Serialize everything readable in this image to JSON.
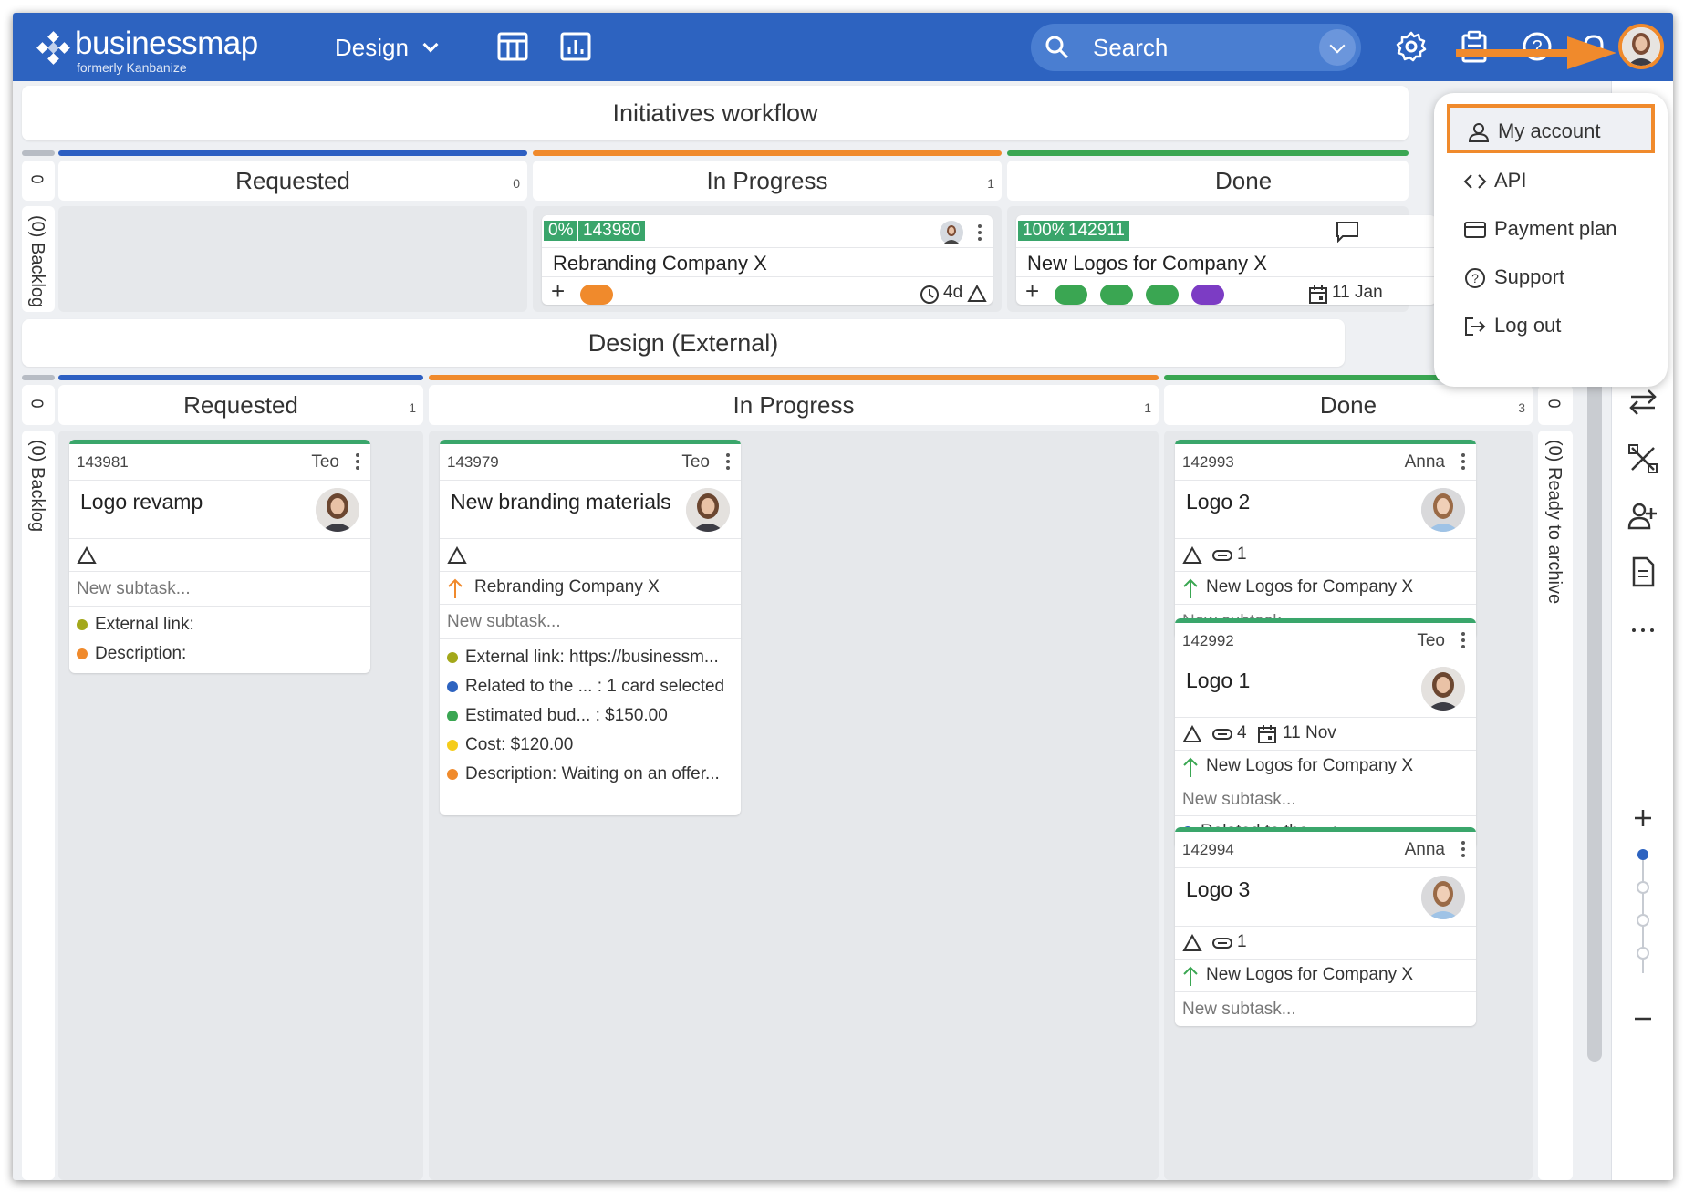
{
  "app": {
    "brand": "businessmap",
    "brand_sub": "formerly Kanbanize",
    "workspace": "Design",
    "search_placeholder": "Search",
    "accent": "#2d63c0",
    "highlight": "#f08a2c"
  },
  "user_menu": {
    "items": [
      {
        "label": "My account",
        "icon": "user-icon"
      },
      {
        "label": "API",
        "icon": "code-icon"
      },
      {
        "label": "Payment plan",
        "icon": "credit-card-icon"
      },
      {
        "label": "Support",
        "icon": "help-icon"
      },
      {
        "label": "Log out",
        "icon": "logout-icon"
      }
    ]
  },
  "initiatives": {
    "title": "Initiatives workflow",
    "backlog_label": "(0) Backlog",
    "backlog_count": "0",
    "columns": [
      {
        "name": "Requested",
        "count": "0",
        "color": "#2d5fc2"
      },
      {
        "name": "In Progress",
        "count": "1",
        "color": "#f08a2c"
      },
      {
        "name": "Done",
        "count": "",
        "color": "#3aa652"
      }
    ],
    "cards": [
      {
        "progress": "0%",
        "id": "143980",
        "title": "Rebranding Company X",
        "time": "4d"
      },
      {
        "progress": "100%",
        "id": "142911",
        "title": "New Logos for Company X",
        "date": "11 Jan"
      }
    ]
  },
  "design": {
    "title": "Design (External)",
    "backlog_label": "(0) Backlog",
    "backlog_count": "0",
    "archive_label": "(0) Ready to archive",
    "archive_count": "0",
    "columns": [
      {
        "name": "Requested",
        "count": "1",
        "color": "#2d5fc2"
      },
      {
        "name": "In Progress",
        "count": "1",
        "color": "#f08a2c"
      },
      {
        "name": "Done",
        "count": "3",
        "color": "#3aa652"
      }
    ],
    "requested_card": {
      "id": "143981",
      "owner": "Teo",
      "title": "Logo revamp",
      "subtask": "New subtask...",
      "fields": [
        {
          "label": "External link:",
          "color": "#a3a81a"
        },
        {
          "label": "Description:",
          "color": "#f08a2c"
        }
      ]
    },
    "progress_card": {
      "id": "143979",
      "owner": "Teo",
      "title": "New branding materials",
      "parent": "Rebranding Company X",
      "subtask": "New subtask...",
      "fields": [
        {
          "label": "External link: https://businessm...",
          "color": "#a3a81a"
        },
        {
          "label": "Related to the ... : 1 card selected",
          "color": "#2d63c0"
        },
        {
          "label": "Estimated bud... : $150.00",
          "color": "#3aa652"
        },
        {
          "label": "Cost: $120.00",
          "color": "#f5cc1a"
        },
        {
          "label": "Description: Waiting on an offer...",
          "color": "#f08a2c"
        }
      ]
    },
    "done_cards": [
      {
        "id": "142993",
        "owner": "Anna",
        "title": "Logo 2",
        "attach": "1",
        "parent": "New Logos for Company X",
        "subtask": "New subtask..."
      },
      {
        "id": "142992",
        "owner": "Teo",
        "title": "Logo 1",
        "attach": "4",
        "date": "11 Nov",
        "parent": "New Logos for Company X",
        "subtask": "New subtask...",
        "field": "Related to the ... :"
      },
      {
        "id": "142994",
        "owner": "Anna",
        "title": "Logo 3",
        "attach": "1",
        "parent": "New Logos for Company X",
        "subtask": "New subtask..."
      }
    ]
  }
}
